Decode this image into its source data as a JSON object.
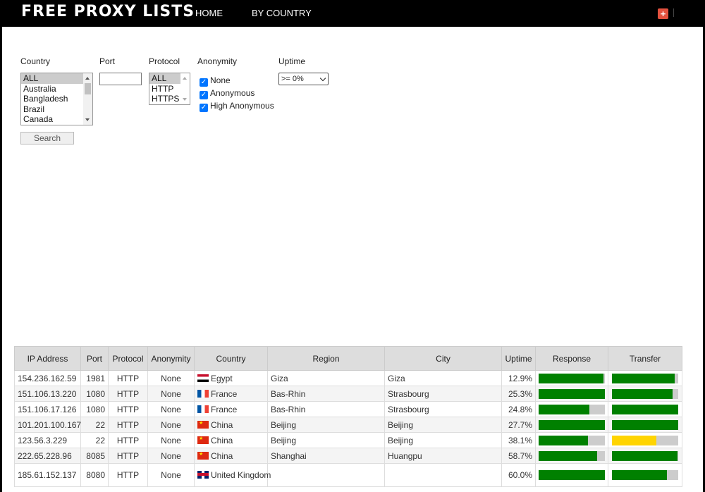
{
  "brand": "FREE PROXY LISTS",
  "nav": {
    "home": "HOME",
    "by_country": "BY COUNTRY",
    "plus": "+"
  },
  "filters": {
    "country_label": "Country",
    "country_options": [
      "ALL",
      "Australia",
      "Bangladesh",
      "Brazil",
      "Canada"
    ],
    "port_label": "Port",
    "port_value": "",
    "protocol_label": "Protocol",
    "protocol_options": [
      "ALL",
      "HTTP",
      "HTTPS"
    ],
    "anonymity_label": "Anonymity",
    "anonymity_options": [
      {
        "label": "None",
        "checked": true
      },
      {
        "label": "Anonymous",
        "checked": true
      },
      {
        "label": "High Anonymous",
        "checked": true
      }
    ],
    "uptime_label": "Uptime",
    "uptime_value": ">= 0%",
    "search_label": "Search"
  },
  "table": {
    "headers": [
      "IP Address",
      "Port",
      "Protocol",
      "Anonymity",
      "Country",
      "Region",
      "City",
      "Uptime",
      "Response",
      "Transfer"
    ],
    "rows": [
      {
        "ip": "154.236.162.59",
        "port": "1981",
        "protocol": "HTTP",
        "anonymity": "None",
        "flag": "eg",
        "country": "Egypt",
        "region": "Giza",
        "city": "Giza",
        "uptime": "12.9%",
        "response": 0.98,
        "transfer": 0.95
      },
      {
        "ip": "151.106.13.220",
        "port": "1080",
        "protocol": "HTTP",
        "anonymity": "None",
        "flag": "fr",
        "country": "France",
        "region": "Bas-Rhin",
        "city": "Strasbourg",
        "uptime": "25.3%",
        "response": 1.0,
        "transfer": 0.92
      },
      {
        "ip": "151.106.17.126",
        "port": "1080",
        "protocol": "HTTP",
        "anonymity": "None",
        "flag": "fr",
        "country": "France",
        "region": "Bas-Rhin",
        "city": "Strasbourg",
        "uptime": "24.8%",
        "response": 0.77,
        "transfer": 1.0
      },
      {
        "ip": "101.201.100.167",
        "port": "22",
        "protocol": "HTTP",
        "anonymity": "None",
        "flag": "cn",
        "country": "China",
        "region": "Beijing",
        "city": "Beijing",
        "uptime": "27.7%",
        "response": 1.0,
        "transfer": 1.0
      },
      {
        "ip": "123.56.3.229",
        "port": "22",
        "protocol": "HTTP",
        "anonymity": "None",
        "flag": "cn",
        "country": "China",
        "region": "Beijing",
        "city": "Beijing",
        "uptime": "38.1%",
        "response": 0.74,
        "transfer": 0.67
      },
      {
        "ip": "222.65.228.96",
        "port": "8085",
        "protocol": "HTTP",
        "anonymity": "None",
        "flag": "cn",
        "country": "China",
        "region": "Shanghai",
        "city": "Huangpu",
        "uptime": "58.7%",
        "response": 0.88,
        "transfer": 0.99
      },
      {
        "ip": "185.61.152.137",
        "port": "8080",
        "protocol": "HTTP",
        "anonymity": "None",
        "flag": "gb",
        "country": "United Kingdom",
        "region": "",
        "city": "",
        "uptime": "60.0%",
        "response": 1.0,
        "transfer": 0.83
      }
    ]
  },
  "colors": {
    "bar_green": "#008000",
    "bar_yellow": "#ffd400",
    "bar_track": "#cccccc"
  }
}
